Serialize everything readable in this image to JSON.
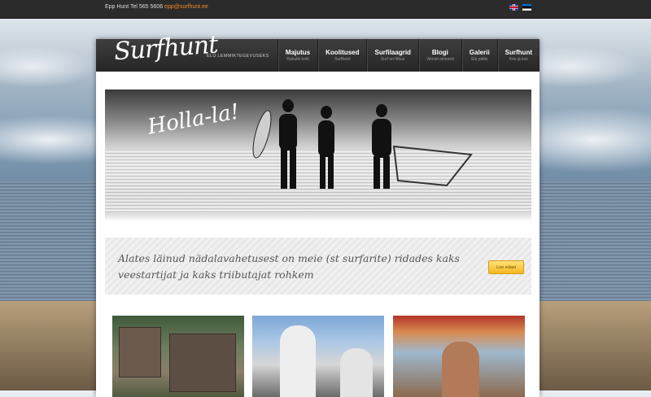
{
  "topbar": {
    "contact_text": "Epp Hunt Tel 565 5606",
    "email": "epp@surfhunt.ee",
    "languages": [
      {
        "name": "uk-flag-icon"
      },
      {
        "name": "estonia-flag-icon"
      }
    ]
  },
  "header": {
    "logo_text": "Surfhunt",
    "tagline": "ELU LEMMIKTEGEVUSEKS",
    "nav": [
      {
        "label": "Majutus",
        "sub": "Rahulik koht"
      },
      {
        "label": "Koolitused",
        "sub": "Surfikool"
      },
      {
        "label": "Surfilaagrid",
        "sub": "Surf on lõbus"
      },
      {
        "label": "Blogi",
        "sub": "Viimati eineesd"
      },
      {
        "label": "Galerii",
        "sub": "Elu pildis"
      },
      {
        "label": "Surfhunt",
        "sub": "Kes ja kus"
      }
    ]
  },
  "hero": {
    "caption": "Holla-la!"
  },
  "promo": {
    "text": "Alates läinud nädalavahetusest on meie (st surfarite) ridades kaks veestartijat ja kaks triibutajat rohkem",
    "button_label": "Loe edasi"
  },
  "colors": {
    "accent_orange": "#f28a27",
    "button_yellow": "#f5b820",
    "header_dark": "#2b2b2b"
  }
}
